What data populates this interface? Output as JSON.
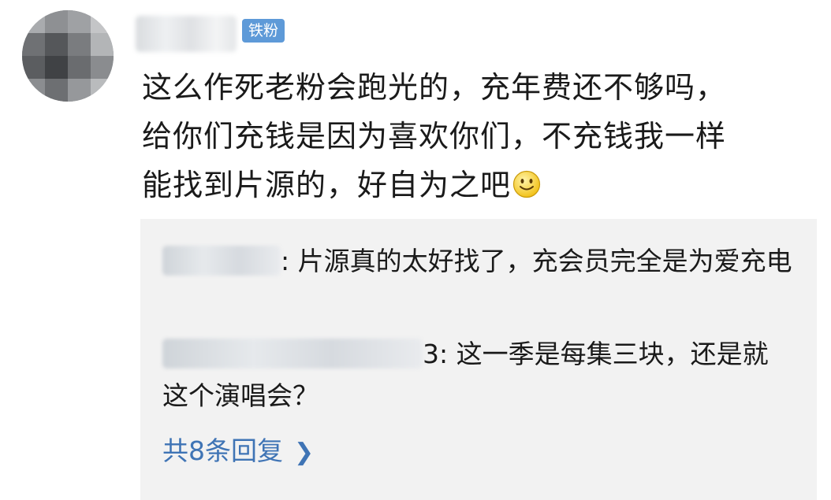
{
  "user": {
    "badge": "铁粉"
  },
  "comment": {
    "lines": [
      "这么作死老粉会跑光的，充年费还不够吗，",
      "给你们充钱是因为喜欢你们，不充钱我一样",
      "能找到片源的，好自为之吧"
    ],
    "emoji": "smiley-icon"
  },
  "replies": [
    {
      "name_suffix": "",
      "separator": ": ",
      "text": "片源真的太好找了，充会员完全是为爱充电"
    },
    {
      "name_suffix": "3",
      "separator": ": ",
      "text": "这一季是每集三块，还是就这个演唱会？"
    }
  ],
  "more_replies": {
    "label": "共8条回复",
    "icon": "chevron-right-icon",
    "color": "#3f74b5"
  },
  "colors": {
    "badge_bg": "#5e9ad8",
    "reply_bg": "#f2f2f2",
    "link": "#3f74b5"
  }
}
